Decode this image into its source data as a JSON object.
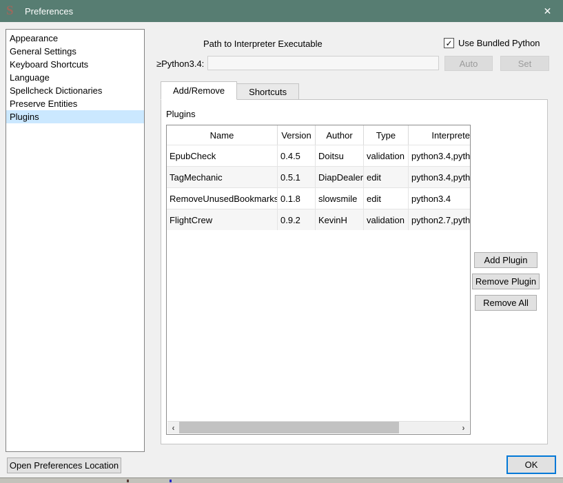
{
  "window": {
    "title": "Preferences",
    "logo_glyph": "S",
    "close_glyph": "✕",
    "titlebar_color": "#577d72"
  },
  "sidebar": {
    "items": [
      {
        "label": "Appearance",
        "selected": false
      },
      {
        "label": "General Settings",
        "selected": false
      },
      {
        "label": "Keyboard Shortcuts",
        "selected": false
      },
      {
        "label": "Language",
        "selected": false
      },
      {
        "label": "Spellcheck Dictionaries",
        "selected": false
      },
      {
        "label": "Preserve Entities",
        "selected": false
      },
      {
        "label": "Plugins",
        "selected": true
      }
    ],
    "selection_color": "#cbe8ff"
  },
  "interpreter": {
    "section_label": "Path to Interpreter Executable",
    "bundled_checkbox_label": "Use Bundled Python",
    "bundled_checked": true,
    "check_glyph": "✓",
    "python_label": "≥Python3.4:",
    "path_value": "",
    "auto_button": "Auto",
    "set_button": "Set"
  },
  "tabs": [
    {
      "label": "Add/Remove",
      "active": true
    },
    {
      "label": "Shortcuts",
      "active": false
    }
  ],
  "plugins_panel": {
    "title": "Plugins",
    "table": {
      "columns": [
        "Name",
        "Version",
        "Author",
        "Type",
        "Interprete"
      ],
      "rows": [
        [
          "EpubCheck",
          "0.4.5",
          "Doitsu",
          "validation",
          "python3.4,pyth"
        ],
        [
          "TagMechanic",
          "0.5.1",
          "DiapDealer",
          "edit",
          "python3.4,pyth"
        ],
        [
          "RemoveUnusedBookmarks",
          "0.1.8",
          "slowsmile",
          "edit",
          "python3.4"
        ],
        [
          "FlightCrew",
          "0.9.2",
          "KevinH",
          "validation",
          "python2.7,pyth"
        ]
      ],
      "alt_row_color": "#f6f6f6"
    },
    "buttons": [
      {
        "label": "Add Plugin"
      },
      {
        "label": "Remove Plugin"
      },
      {
        "label": "Remove All"
      }
    ],
    "scrollbar": {
      "left_arrow": "‹",
      "right_arrow": "›"
    }
  },
  "footer": {
    "open_prefs_button": "Open Preferences Location",
    "ok_button": "OK"
  }
}
